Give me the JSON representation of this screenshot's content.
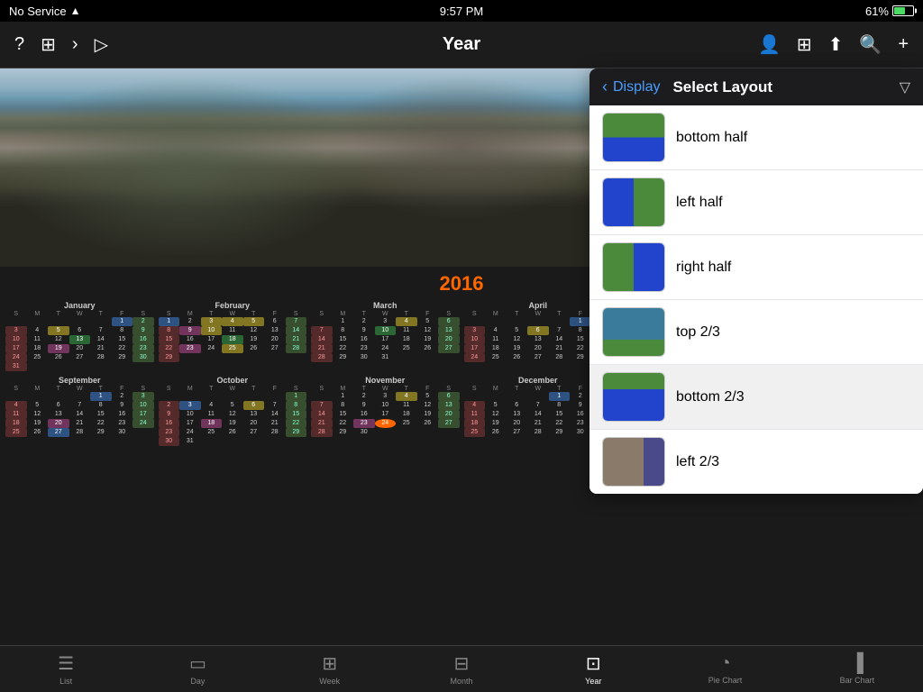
{
  "status": {
    "carrier": "No Service",
    "wifi": true,
    "time": "9:57 PM",
    "battery_pct": "61%"
  },
  "nav": {
    "title": "Year",
    "back_label": "Display",
    "dropdown_title": "Select Layout"
  },
  "year": "2016",
  "layout_options": [
    {
      "id": "bottom-half",
      "label": "bottom half",
      "thumb": "bottom-half"
    },
    {
      "id": "left-half",
      "label": "left half",
      "thumb": "left-half"
    },
    {
      "id": "right-half",
      "label": "right half",
      "thumb": "right-half"
    },
    {
      "id": "top-23",
      "label": "top 2/3",
      "thumb": "top-23"
    },
    {
      "id": "bottom-23",
      "label": "bottom 2/3",
      "thumb": "bottom-23",
      "selected": true
    },
    {
      "id": "left-23",
      "label": "left 2/3",
      "thumb": "left-23"
    }
  ],
  "tabs": [
    {
      "id": "list",
      "label": "List",
      "icon": "☰"
    },
    {
      "id": "day",
      "label": "Day",
      "icon": "▭"
    },
    {
      "id": "week",
      "label": "Week",
      "icon": "⊞"
    },
    {
      "id": "month",
      "label": "Month",
      "icon": "⊟"
    },
    {
      "id": "year",
      "label": "Year",
      "icon": "⊡"
    },
    {
      "id": "pie-chart",
      "label": "Pie Chart",
      "icon": "◔"
    },
    {
      "id": "bar-chart",
      "label": "Bar Chart",
      "icon": "▐"
    }
  ]
}
